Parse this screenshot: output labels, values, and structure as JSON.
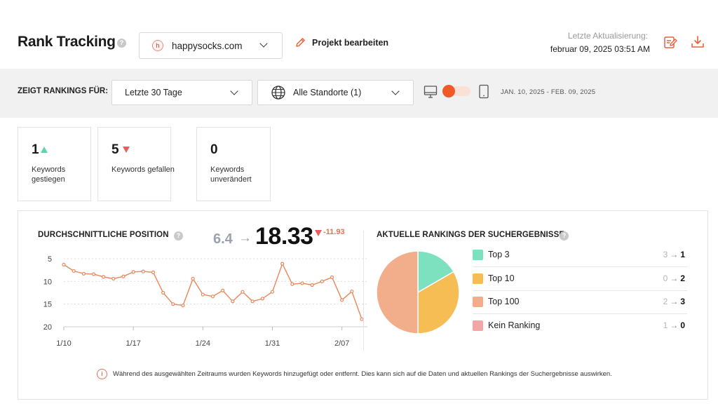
{
  "header": {
    "title": "Rank Tracking",
    "help_glyph": "?",
    "domain_favicon": "h",
    "domain": "happysocks.com",
    "edit_project": "Projekt bearbeiten",
    "last_update_label": "Letzte Aktualisierung:",
    "last_update_value": "februar 09, 2025 03:51 AM",
    "icons": [
      "edit-report-icon",
      "download-icon"
    ]
  },
  "filters": {
    "label": "ZEIGT RANKINGS FÜR:",
    "period": "Letzte 30 Tage",
    "location": "Alle Standorte (1)",
    "devices": [
      "desktop-icon",
      "mobile-icon"
    ],
    "date_range": "JAN. 10, 2025 - FEB. 09, 2025",
    "accent_color": "#f05a28"
  },
  "stats": [
    {
      "value": "1",
      "label": "Keywords gestiegen",
      "trend": "up"
    },
    {
      "value": "5",
      "label": "Keywords gefallen",
      "trend": "down"
    },
    {
      "value": "0",
      "label": "Keywords unverändert",
      "trend": "none"
    }
  ],
  "avg_position": {
    "title": "DURCHSCHNITTLICHE POSITION",
    "previous": "6.4",
    "arrow": "→",
    "current": "18.33",
    "delta": "-11.93"
  },
  "serp": {
    "title": "AKTUELLE RANKINGS DER SUCHERGEBNISSE",
    "rows": [
      {
        "name": "Top 3",
        "old": "3",
        "new": "1",
        "color": "#7de0bf"
      },
      {
        "name": "Top 10",
        "old": "0",
        "new": "2",
        "color": "#f7bd55"
      },
      {
        "name": "Top 100",
        "old": "2",
        "new": "3",
        "color": "#f2ad8a"
      },
      {
        "name": "Kein Ranking",
        "old": "1",
        "new": "0",
        "color": "#f2a6a6"
      }
    ]
  },
  "notice": {
    "icon": "i",
    "text": "Während des ausgewählten Zeitraums wurden Keywords hinzugefügt oder entfernt. Dies kann sich auf die Daten und aktuellen Rankings der Suchergebnisse auswirken."
  },
  "chart_data": [
    {
      "type": "line",
      "title": "DURCHSCHNITTLICHE POSITION",
      "ylim": [
        20,
        5
      ],
      "y_inverted": true,
      "yticks": [
        5,
        10,
        15,
        20
      ],
      "xticks": [
        "1/10",
        "1/17",
        "1/24",
        "1/31",
        "2/07"
      ],
      "grid": true,
      "line_color": "#e8875a",
      "x": [
        "1/10",
        "1/11",
        "1/12",
        "1/13",
        "1/14",
        "1/15",
        "1/16",
        "1/17",
        "1/18",
        "1/19",
        "1/20",
        "1/21",
        "1/22",
        "1/23",
        "1/24",
        "1/25",
        "1/26",
        "1/27",
        "1/28",
        "1/29",
        "1/30",
        "1/31",
        "2/01",
        "2/02",
        "2/03",
        "2/04",
        "2/05",
        "2/06",
        "2/07",
        "2/08",
        "2/09"
      ],
      "values": [
        6.3,
        7.7,
        8.3,
        8.4,
        9.0,
        9.4,
        8.9,
        7.9,
        7.8,
        8.0,
        12.5,
        15.0,
        15.3,
        9.4,
        12.9,
        13.3,
        12.0,
        14.4,
        12.3,
        14.4,
        13.8,
        12.3,
        6.1,
        10.6,
        10.4,
        10.8,
        10.0,
        9.1,
        14.1,
        12.2,
        18.33
      ]
    },
    {
      "type": "pie",
      "title": "AKTUELLE RANKINGS DER SUCHERGEBNISSE",
      "labels": [
        "Top 3",
        "Top 10",
        "Top 100",
        "Kein Ranking"
      ],
      "values": [
        1,
        2,
        3,
        0
      ],
      "colors": [
        "#7de0bf",
        "#f7bd55",
        "#f2ad8a",
        "#f2a6a6"
      ]
    }
  ]
}
